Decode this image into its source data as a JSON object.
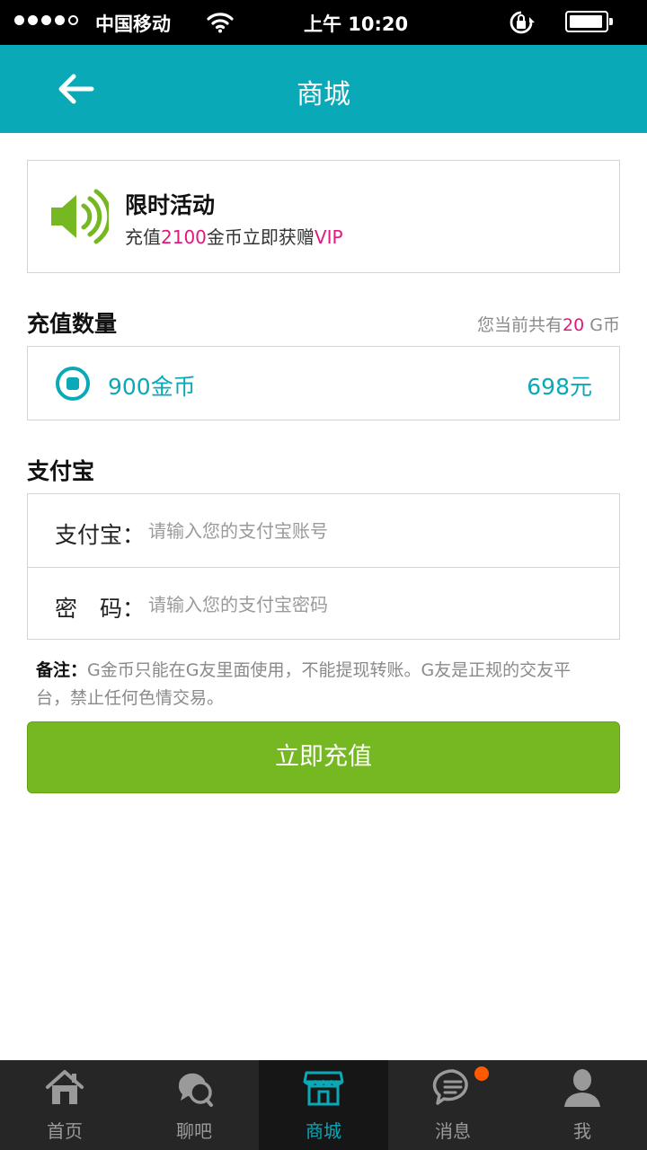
{
  "status": {
    "carrier": "中国移动",
    "time": "上午 10:20",
    "battery_level": 0.85,
    "signal_bars": 4
  },
  "nav": {
    "title": "商城",
    "back_icon": "arrow-left-icon"
  },
  "promo": {
    "icon": "speaker-icon",
    "title": "限时活动",
    "desc_prefix": "充值",
    "desc_amount": "2100",
    "desc_middle": "金币立即获赠",
    "desc_vip": "VIP"
  },
  "recharge": {
    "section_title": "充值数量",
    "balance_prefix": "您当前共有",
    "balance_amount": "20",
    "balance_suffix": " G币",
    "option_label": "900金币",
    "option_price": "698元"
  },
  "alipay": {
    "section_title": "支付宝",
    "account_label": "支付宝：",
    "account_placeholder": "请输入您的支付宝账号",
    "password_label": "密　码：",
    "password_placeholder": "请输入您的支付宝密码"
  },
  "note": {
    "label": "备注：",
    "text": "G金币只能在G友里面使用，不能提现转账。G友是正规的交友平台，禁止任何色情交易。"
  },
  "submit_label": "立即充值",
  "tabs": [
    {
      "label": "首页",
      "icon": "home-icon"
    },
    {
      "label": "聊吧",
      "icon": "chat-bubbles-icon"
    },
    {
      "label": "商城",
      "icon": "store-icon",
      "active": true
    },
    {
      "label": "消息",
      "icon": "message-icon",
      "badge": true
    },
    {
      "label": "我",
      "icon": "person-icon"
    }
  ],
  "colors": {
    "primary": "#0aa9b8",
    "accent_pink": "#e3177e",
    "button_green": "#76b822",
    "badge_orange": "#ff5a00",
    "tabbar_bg": "#262626"
  }
}
